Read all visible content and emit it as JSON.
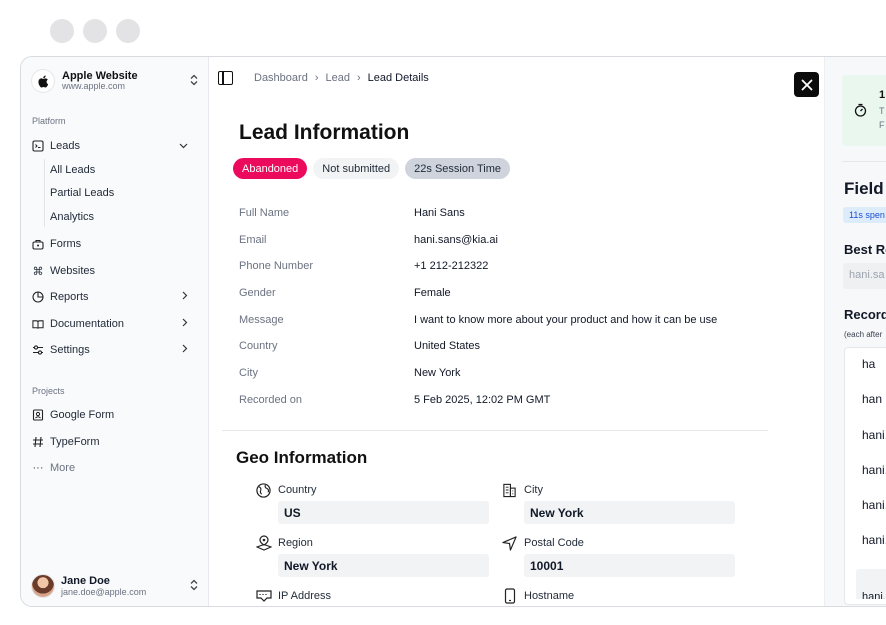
{
  "brand": {
    "name": "Apple Website",
    "url": "www.apple.com"
  },
  "sidebar": {
    "platform_label": "Platform",
    "items": [
      {
        "label": "Leads",
        "icon": "leads-icon"
      },
      {
        "label": "Forms",
        "icon": "forms-icon"
      },
      {
        "label": "Websites",
        "icon": "command-icon"
      },
      {
        "label": "Reports",
        "icon": "pie-chart-icon"
      },
      {
        "label": "Documentation",
        "icon": "book-icon"
      },
      {
        "label": "Settings",
        "icon": "sliders-icon"
      }
    ],
    "sub_items": [
      "All Leads",
      "Partial Leads",
      "Analytics"
    ],
    "projects_label": "Projects",
    "projects": [
      {
        "label": "Google Form",
        "icon": "contact-icon"
      },
      {
        "label": "TypeForm",
        "icon": "hash-icon"
      },
      {
        "label": "More",
        "icon": "ellipsis-icon"
      }
    ]
  },
  "user": {
    "name": "Jane Doe",
    "email": "jane.doe@apple.com"
  },
  "breadcrumb": [
    "Dashboard",
    "Lead",
    "Lead Details"
  ],
  "lead": {
    "title": "Lead Information",
    "badges": [
      "Abandoned",
      "Not submitted",
      "22s Session Time"
    ],
    "fields": [
      {
        "label": "Full Name",
        "value": "Hani Sans"
      },
      {
        "label": "Email",
        "value": "hani.sans@kia.ai"
      },
      {
        "label": "Phone Number",
        "value": "+1 212-212322"
      },
      {
        "label": "Gender",
        "value": "Female"
      },
      {
        "label": "Message",
        "value": "I want to know more about your product and how it can be use"
      },
      {
        "label": "Country",
        "value": "United States"
      },
      {
        "label": "City",
        "value": "New York"
      },
      {
        "label": "Recorded on",
        "value": "5 Feb 2025, 12:02 PM GMT"
      }
    ]
  },
  "geo": {
    "title": "Geo Information",
    "fields": [
      {
        "label": "Country",
        "value": "US",
        "icon": "globe-icon"
      },
      {
        "label": "City",
        "value": "New York",
        "icon": "building-icon"
      },
      {
        "label": "Region",
        "value": "New York",
        "icon": "map-pin-icon"
      },
      {
        "label": "Postal Code",
        "value": "10001",
        "icon": "navigation-icon"
      },
      {
        "label": "IP Address",
        "value": "",
        "icon": "ip-icon"
      },
      {
        "label": "Hostname",
        "value": "",
        "icon": "tablet-icon"
      }
    ]
  },
  "right_panel": {
    "stat_number": "1",
    "stat_line1": "T",
    "stat_line2": "F",
    "field_title": "Field",
    "chip": "11s spen",
    "best_label": "Best Re",
    "best_value": "hani.sa",
    "records_label": "Record",
    "records_note": "(each after",
    "records": [
      "ha",
      "han",
      "hani.",
      "hani.",
      "hani.",
      "hani.",
      "hani."
    ]
  }
}
